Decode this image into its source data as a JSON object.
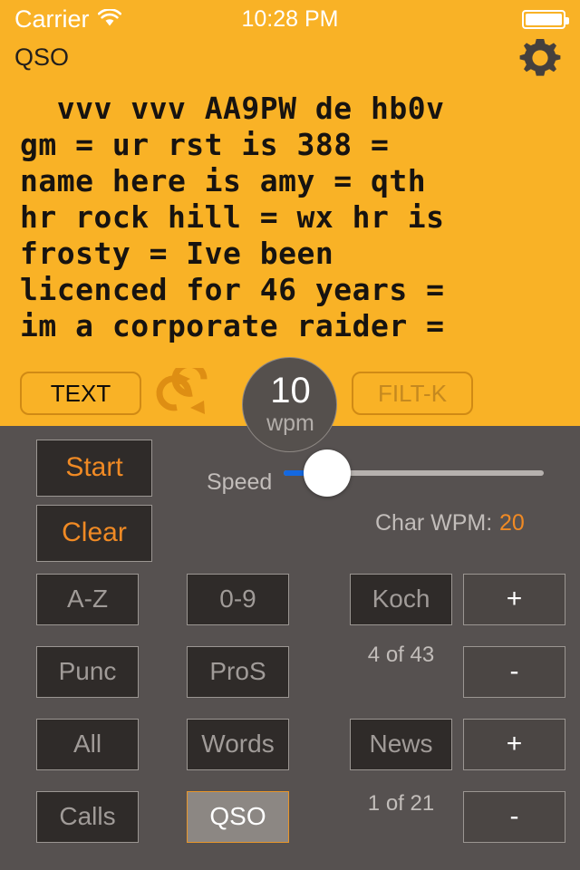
{
  "status_bar": {
    "carrier": "Carrier",
    "time": "10:28 PM",
    "wifi_icon": "wifi-icon",
    "battery_icon": "battery-icon"
  },
  "nav": {
    "title": "QSO",
    "settings_icon": "gear-icon"
  },
  "readout": {
    "text": "  vvv vvv AA9PW de hb0v\ngm = ur rst is 388 =\nname here is amy = qth\nhr rock hill = wx hr is\nfrosty = Ive been\nlicenced for 46 years =\nim a corporate raider ="
  },
  "control_bar": {
    "text_button": "TEXT",
    "loop_icon": "repeat-loop-icon",
    "filter_button": "FILT-K",
    "wpm_dial": {
      "value": "10",
      "unit": "wpm"
    }
  },
  "actions": {
    "start": "Start",
    "clear": "Clear"
  },
  "speed": {
    "label": "Speed",
    "char_wpm_label": "Char WPM:",
    "char_wpm_value": "20"
  },
  "modes": {
    "col1": [
      "A-Z",
      "Punc",
      "All",
      "Calls"
    ],
    "col2": [
      "0-9",
      "ProS",
      "Words",
      "QSO"
    ],
    "col3": [
      "Koch",
      "News"
    ],
    "selected": "QSO"
  },
  "steppers": {
    "koch_plus": "+",
    "koch_minus": "-",
    "news_plus": "+",
    "news_minus": "-"
  },
  "counters": {
    "koch": "4 of 43",
    "news": "1 of 21"
  },
  "colors": {
    "orange_bg": "#F9B226",
    "gray_bg": "#565150",
    "accent_orange": "#F08A24",
    "button_dark": "#2f2b29",
    "slider_blue": "#1468e0",
    "selected_border": "#E8962A"
  }
}
